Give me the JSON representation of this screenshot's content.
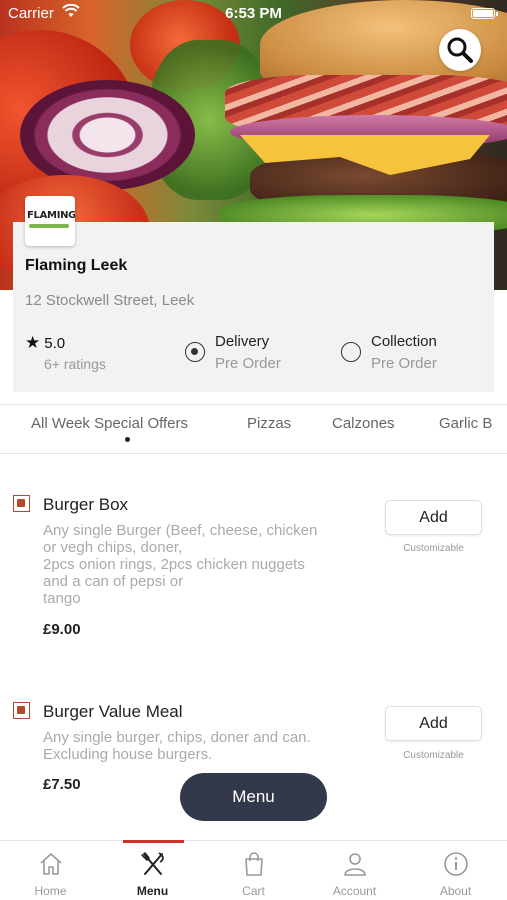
{
  "status_bar": {
    "carrier": "Carrier",
    "time": "6:53 PM"
  },
  "restaurant": {
    "logo_text": "FLAMING",
    "name": "Flaming Leek",
    "address": "12 Stockwell Street, Leek",
    "rating": "5.0",
    "ratings_count": "6+ ratings"
  },
  "order_options": [
    {
      "title": "Delivery",
      "subtitle": "Pre Order",
      "selected": true
    },
    {
      "title": "Collection",
      "subtitle": "Pre Order",
      "selected": false
    }
  ],
  "tabs": [
    "All Week Special Offers",
    "Pizzas",
    "Calzones",
    "Garlic B"
  ],
  "active_tab": "All Week Special Offers",
  "menu_items": [
    {
      "title": "Burger Box",
      "description": [
        "Any single Burger (Beef, cheese, chicken",
        "or vegh chips, doner,",
        "2pcs onion rings, 2pcs chicken nuggets",
        "and a can of pepsi or",
        "tango"
      ],
      "price": "£9.00",
      "add_label": "Add",
      "note": "Customizable"
    },
    {
      "title": "Burger Value Meal",
      "description": [
        "Any single burger, chips, doner and can.",
        "Excluding house burgers."
      ],
      "price": "£7.50",
      "add_label": "Add",
      "note": "Customizable"
    }
  ],
  "floating_button": "Menu",
  "bottom_nav": [
    {
      "label": "Home",
      "icon": "home-icon"
    },
    {
      "label": "Menu",
      "icon": "fork-knife-icon",
      "active": true
    },
    {
      "label": "Cart",
      "icon": "shopping-bag-icon"
    },
    {
      "label": "Account",
      "icon": "user-icon"
    },
    {
      "label": "About",
      "icon": "info-icon"
    }
  ],
  "colors": {
    "accent": "#d0312d",
    "veg_marker": "#b5482e",
    "floating_button": "#33384a"
  }
}
